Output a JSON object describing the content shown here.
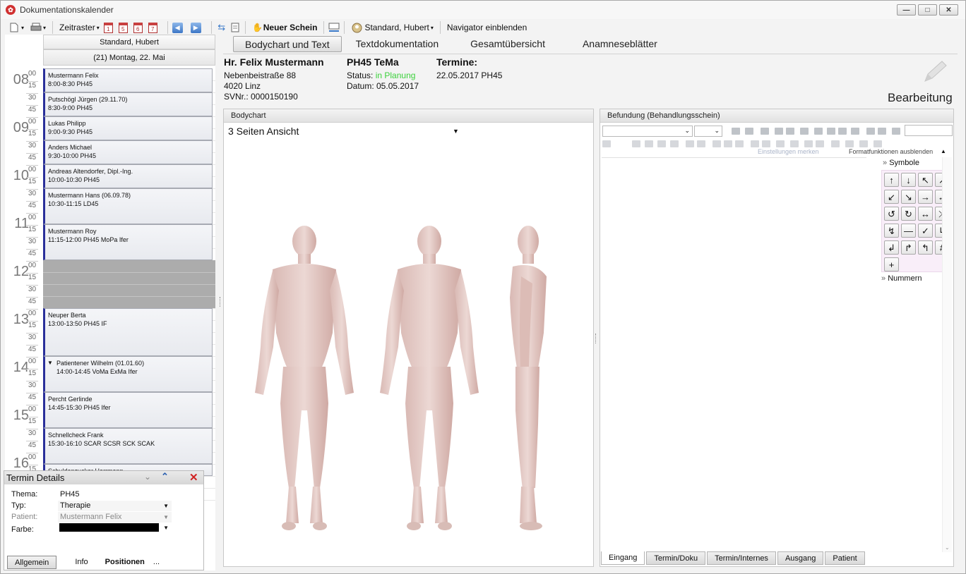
{
  "window": {
    "title": "Dokumentationskalender",
    "buttons": [
      "—",
      "□",
      "✕"
    ]
  },
  "toolbar": {
    "zeitraster": "Zeitraster",
    "calendar_days": [
      "1",
      "5",
      "6",
      "7"
    ],
    "neuer_schein": "Neuer Schein",
    "user": "Standard, Hubert",
    "navigator": "Navigator einblenden"
  },
  "calendar": {
    "owner": "Standard, Hubert",
    "date": "(21) Montag, 22. Mai",
    "hours": [
      "08",
      "09",
      "10",
      "11",
      "12",
      "13",
      "14",
      "15",
      "16"
    ],
    "minutes": [
      "00",
      "15",
      "30",
      "45"
    ],
    "appointments": [
      {
        "name": "Mustermann Felix",
        "time": "8:00-8:30 PH45"
      },
      {
        "name": "Putschögl Jürgen (29.11.70)",
        "time": "8:30-9:00 PH45"
      },
      {
        "name": "Lukas Philipp",
        "time": "9:00-9:30 PH45"
      },
      {
        "name": "Anders Michael",
        "time": "9:30-10:00 PH45"
      },
      {
        "name": "Andreas Altendorfer, Dipl.-Ing.",
        "time": "10:00-10:30 PH45"
      },
      {
        "name": "Mustermann Hans (06.09.78)",
        "time": "10:30-11:15 LD45"
      },
      {
        "name": "Mustermann Roy",
        "time": "11:15-12:00 PH45 MoPa Ifer"
      },
      {
        "name": "Neuper Berta",
        "time": "13:00-13:50 PH45 IF"
      },
      {
        "name": "Patientener Wilhelm (01.01.60)",
        "time": "14:00-14:45 VoMa ExMa Ifer"
      },
      {
        "name": "Percht Gerlinde",
        "time": "14:45-15:30 PH45 Ifer"
      },
      {
        "name": "Schnellcheck Frank",
        "time": "15:30-16:10 SCAR SCSR SCK SCAK"
      },
      {
        "name": "Schuldenzucker Herrmann",
        "time": ""
      }
    ]
  },
  "termin_details": {
    "title": "Termin Details",
    "fields": [
      {
        "label": "Thema:",
        "value": "PH45"
      },
      {
        "label": "Typ:",
        "value": "Therapie"
      },
      {
        "label": "Patient:",
        "value": "Mustermann Felix"
      },
      {
        "label": "Farbe:",
        "value": ""
      }
    ],
    "tabs": [
      "Allgemein",
      "Info",
      "Positionen",
      "..."
    ]
  },
  "tabs": [
    "Bodychart und Text",
    "Textdokumentation",
    "Gesamtübersicht",
    "Anamneseblätter"
  ],
  "patient": {
    "name": "Hr. Felix Mustermann",
    "street": "Nebenbeistraße 88",
    "city": "4020 Linz",
    "svnr": "SVNr.: 0000150190"
  },
  "schein": {
    "title": "PH45 TeMa",
    "status_label": "Status:",
    "status_value": "in Planung",
    "datum": "Datum: 05.05.2017"
  },
  "termine": {
    "title": "Termine:",
    "entry": "22.05.2017 PH45"
  },
  "bearbeitung": "Bearbeitung",
  "bodychart": {
    "title": "Bodychart",
    "view": "3 Seiten Ansicht"
  },
  "befund": {
    "title": "Befundung (Behandlungsschein)",
    "einstellungen": "Einstellungen merken",
    "format": "Formatfunktionen ausblenden",
    "symbole": "Symbole",
    "nummern": "Nummern",
    "symbols": [
      "↑",
      "↓",
      "↖",
      "↗",
      "↙",
      "↘",
      "→",
      "←",
      "↺",
      "↻",
      "↔",
      "⤫",
      "↯",
      "—",
      "✓",
      "↳",
      "↲",
      "↱",
      "↰",
      "#",
      "+"
    ],
    "tabs": [
      "Eingang",
      "Termin/Doku",
      "Termin/Internes",
      "Ausgang",
      "Patient"
    ]
  },
  "colors": {
    "accent": "#2a2f9a",
    "status_green": "#3bd13b",
    "blocked": "#acacac"
  }
}
